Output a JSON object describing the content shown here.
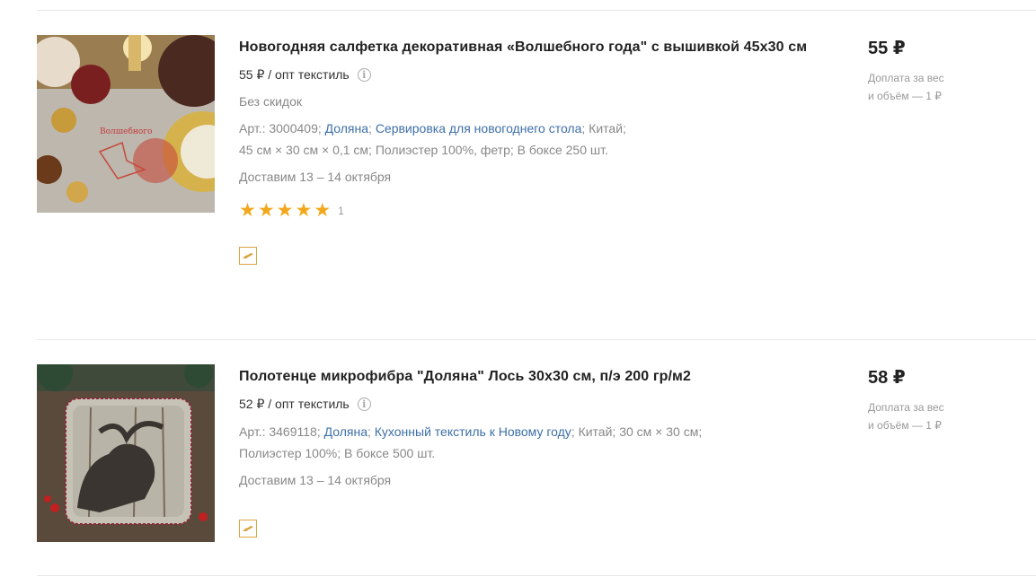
{
  "products": [
    {
      "title": "Новогодняя салфетка декоративная «Волшебного года\" с вышивкой 45х30 см",
      "wholesale_text": "55 ₽ / опт текстиль",
      "discount_text": "Без скидок",
      "article": "Арт.: 3000409;",
      "brand_link": "Доляна",
      "category_link": "Сервировка для новогоднего стола",
      "country": "Китай;",
      "specs": "45 см × 30 см × 0,1 см;  Полиэстер 100%, фетр;  В боксе 250 шт.",
      "delivery": "Доставим 13 – 14 октября",
      "rating_stars": 5,
      "rating_count": "1",
      "price": "55 ₽",
      "extra_line1": "Доплата за вес",
      "extra_line2": "и объём — 1 ₽",
      "icons": [
        "info-icon",
        "star-icon",
        "courier-badge-icon"
      ]
    },
    {
      "title": "Полотенце микрофибра \"Доляна\" Лось 30х30 см, п/э 200 гр/м2",
      "wholesale_text": "52 ₽ / опт текстиль",
      "article": "Арт.: 3469118;",
      "brand_link": "Доляна",
      "category_link": "Кухонный текстиль к Новому году",
      "country": "Китай;",
      "size": "30 см × 30 см;",
      "specs": "Полиэстер 100%;  В боксе 500 шт.",
      "delivery": "Доставим 13 – 14 октября",
      "price": "58 ₽",
      "extra_line1": "Доплата за вес",
      "extra_line2": "и объём — 1 ₽",
      "icons": [
        "info-icon",
        "courier-badge-icon"
      ]
    }
  ],
  "colors": {
    "link": "#3d6fa8",
    "star": "#f2a81d",
    "badge_border": "#d9a440",
    "muted_text": "#888888",
    "divider": "#e6e6e6"
  }
}
